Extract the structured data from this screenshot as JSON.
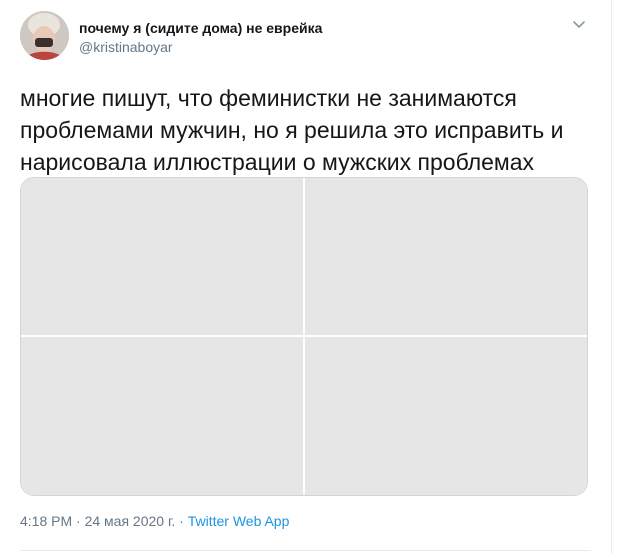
{
  "tweet": {
    "author": {
      "display_name": "почему я (сидите дома) не еврейка",
      "handle": "@kristinaboyar"
    },
    "text": "многие пишут, что феминистки не занимаются проблемами мужчин, но я решила это исправить и нарисовала иллюстрации о мужских проблемах",
    "media_count": 4,
    "timestamp": "4:18 PM · 24 мая 2020 г.",
    "separator": " · ",
    "source": "Twitter Web App"
  },
  "icons": {
    "menu": "chevron-down-icon"
  },
  "colors": {
    "text": "#14171a",
    "secondary_text": "#657786",
    "link": "#1b95e0",
    "media_placeholder": "#e6e6e6",
    "border": "#ccd6dd"
  }
}
